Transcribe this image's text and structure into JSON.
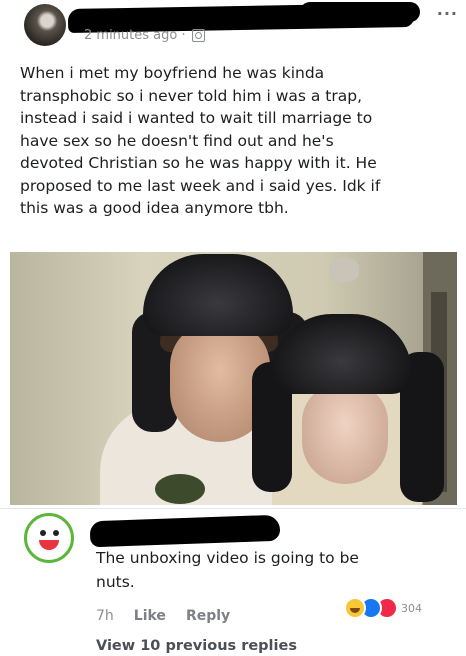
{
  "post": {
    "timestamp": "2 minutes ago ·",
    "body": "When i met my boyfriend he was kinda\ntransphobic so i never told him i was a trap,\ninstead i said i wanted to wait till marriage to\nhave sex so he doesn't find out and he's\ndevoted Christian so he was happy with it. He\nproposed to me last week  and i said yes. Idk if\nthis was a good idea anymore tbh.",
    "more_label": "···"
  },
  "comment": {
    "text": "The unboxing video is going to be\nnuts.",
    "time": "7h",
    "like_label": "Like",
    "reply_label": "Reply",
    "reaction_count": "304",
    "view_replies": "View 10 previous replies"
  },
  "colors": {
    "avatar_ring": "#5bb63a",
    "like_blue": "#1877f2",
    "love_red": "#f0284a",
    "haha_yellow": "#f7c835"
  }
}
